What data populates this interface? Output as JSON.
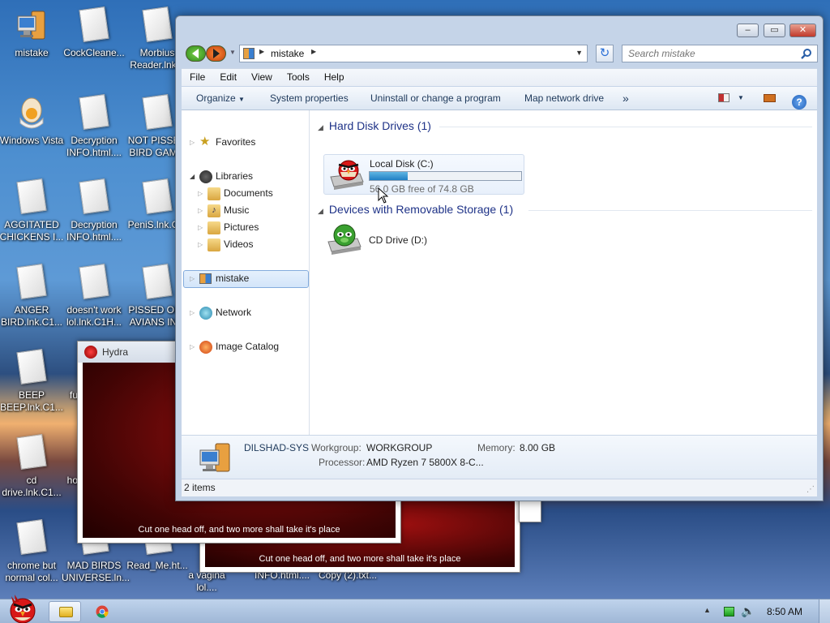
{
  "desktop": {
    "icons": [
      {
        "label": "mistake",
        "kind": "computer"
      },
      {
        "label": "CockCleane...",
        "kind": "doc"
      },
      {
        "label": "Morbius Reader.lnk...",
        "kind": "doc"
      },
      {
        "label": "Windows Vista",
        "kind": "egg"
      },
      {
        "label": "Decryption INFO.html....",
        "kind": "doc"
      },
      {
        "label": "NOT PISSED BIRD GAM...",
        "kind": "doc"
      },
      {
        "label": "AGGITATED CHICKENS I...",
        "kind": "doc"
      },
      {
        "label": "Decryption INFO.html....",
        "kind": "doc"
      },
      {
        "label": "PeniS.lnk.C...",
        "kind": "doc"
      },
      {
        "label": "ANGER BIRD.lnk.C1...",
        "kind": "doc"
      },
      {
        "label": "doesn't work lol.lnk.C1H...",
        "kind": "doc"
      },
      {
        "label": "PISSED OFF AVIANS IN...",
        "kind": "doc"
      },
      {
        "label": "BEEP BEEP.lnk.C1...",
        "kind": "doc"
      },
      {
        "label": "fu...",
        "kind": "doc"
      },
      {
        "label": "cd drive.lnk.C1...",
        "kind": "doc"
      },
      {
        "label": "ho...",
        "kind": "doc"
      },
      {
        "label": "chrome but normal col...",
        "kind": "doc"
      },
      {
        "label": "MAD BIRDS UNIVERSE.ln...",
        "kind": "doc"
      },
      {
        "label": "Read_Me.ht...",
        "kind": "doc"
      },
      {
        "label": "a vagina lol....",
        "kind": "doc"
      },
      {
        "label": "INFO.html....",
        "kind": "doc"
      },
      {
        "label": "Copy (2).txt...",
        "kind": "doc"
      }
    ]
  },
  "hydra": {
    "title": "Hydra",
    "caption": "Cut one head off, and two more shall take it's place"
  },
  "explorer": {
    "address": "mistake",
    "search_placeholder": "Search mistake",
    "menu": [
      "File",
      "Edit",
      "View",
      "Tools",
      "Help"
    ],
    "toolbar": {
      "organize": "Organize",
      "system_properties": "System properties",
      "uninstall": "Uninstall or change a program",
      "map_drive": "Map network drive",
      "more": "»"
    },
    "nav": {
      "favorites": "Favorites",
      "libraries": "Libraries",
      "documents": "Documents",
      "music": "Music",
      "pictures": "Pictures",
      "videos": "Videos",
      "computer": "mistake",
      "network": "Network",
      "image_catalog": "Image Catalog"
    },
    "groups": {
      "hdd": "Hard Disk Drives (1)",
      "removable": "Devices with Removable Storage (1)"
    },
    "drives": {
      "c_name": "Local Disk (C:)",
      "c_free": "56.0 GB free of 74.8 GB",
      "c_used_fraction": 0.25,
      "d_name": "CD Drive (D:)"
    },
    "details": {
      "computer_name": "DILSHAD-SYS",
      "workgroup_label": "Workgroup:",
      "workgroup": "WORKGROUP",
      "memory_label": "Memory:",
      "memory": "8.00 GB",
      "processor_label": "Processor:",
      "processor": "AMD Ryzen 7 5800X 8-C..."
    },
    "status": "2 items"
  },
  "taskbar": {
    "clock": "8:50 AM"
  }
}
